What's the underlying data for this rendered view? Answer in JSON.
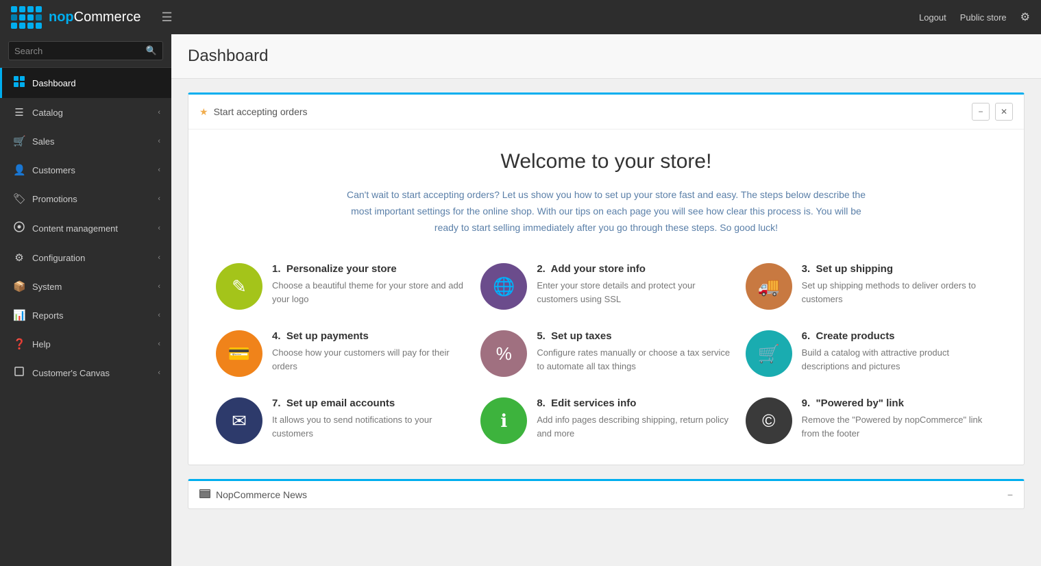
{
  "topbar": {
    "brand": "nopCommerce",
    "brand_accent": "nop",
    "logout_label": "Logout",
    "public_store_label": "Public store"
  },
  "sidebar": {
    "search_placeholder": "Search",
    "items": [
      {
        "id": "dashboard",
        "label": "Dashboard",
        "icon": "⊞",
        "active": true,
        "has_arrow": false
      },
      {
        "id": "catalog",
        "label": "Catalog",
        "icon": "≡",
        "active": false,
        "has_arrow": true
      },
      {
        "id": "sales",
        "label": "Sales",
        "icon": "🛒",
        "active": false,
        "has_arrow": true
      },
      {
        "id": "customers",
        "label": "Customers",
        "icon": "👤",
        "active": false,
        "has_arrow": true
      },
      {
        "id": "promotions",
        "label": "Promotions",
        "icon": "🏷",
        "active": false,
        "has_arrow": true
      },
      {
        "id": "content-management",
        "label": "Content management",
        "icon": "⚙",
        "active": false,
        "has_arrow": true
      },
      {
        "id": "configuration",
        "label": "Configuration",
        "icon": "⚙",
        "active": false,
        "has_arrow": true
      },
      {
        "id": "system",
        "label": "System",
        "icon": "📦",
        "active": false,
        "has_arrow": true
      },
      {
        "id": "reports",
        "label": "Reports",
        "icon": "📊",
        "active": false,
        "has_arrow": true
      },
      {
        "id": "help",
        "label": "Help",
        "icon": "?",
        "active": false,
        "has_arrow": true
      },
      {
        "id": "customers-canvas",
        "label": "Customer's Canvas",
        "icon": "□",
        "active": false,
        "has_arrow": true
      }
    ]
  },
  "page": {
    "title": "Dashboard"
  },
  "welcome_card": {
    "header_title": "Start accepting orders",
    "welcome_title": "Welcome to your store!",
    "welcome_desc": "Can't wait to start accepting orders? Let us show you how to set up your store fast and easy. The steps below describe the most important settings for the online shop. With our tips on each page you will see how clear this process is. You will be ready to start selling immediately after you go through these steps. So good luck!",
    "steps": [
      {
        "number": "1.",
        "title": "Personalize your store",
        "desc": "Choose a beautiful theme for your store and add your logo",
        "color_class": "color-yellow-green",
        "icon": "✎"
      },
      {
        "number": "2.",
        "title": "Add your store info",
        "desc": "Enter your store details and protect your customers using SSL",
        "color_class": "color-purple",
        "icon": "🌐"
      },
      {
        "number": "3.",
        "title": "Set up shipping",
        "desc": "Set up shipping methods to deliver orders to customers",
        "color_class": "color-orange-brown",
        "icon": "🚚"
      },
      {
        "number": "4.",
        "title": "Set up payments",
        "desc": "Choose how your customers will pay for their orders",
        "color_class": "color-orange",
        "icon": "💳"
      },
      {
        "number": "5.",
        "title": "Set up taxes",
        "desc": "Configure rates manually or choose a tax service to automate all tax things",
        "color_class": "color-mauve",
        "icon": "%"
      },
      {
        "number": "6.",
        "title": "Create products",
        "desc": "Build a catalog with attractive product descriptions and pictures",
        "color_class": "color-teal",
        "icon": "🛒"
      },
      {
        "number": "7.",
        "title": "Set up email accounts",
        "desc": "It allows you to send notifications to your customers",
        "color_class": "color-dark-blue",
        "icon": "✉"
      },
      {
        "number": "8.",
        "title": "Edit services info",
        "desc": "Add info pages describing shipping, return policy and more",
        "color_class": "color-green",
        "icon": "ℹ"
      },
      {
        "number": "9.",
        "title": "\"Powered by\" link",
        "desc": "Remove the \"Powered by nopCommerce\" link from the footer",
        "color_class": "color-dark-gray",
        "icon": "©"
      }
    ]
  },
  "news_card": {
    "header_title": "NopCommerce News"
  }
}
